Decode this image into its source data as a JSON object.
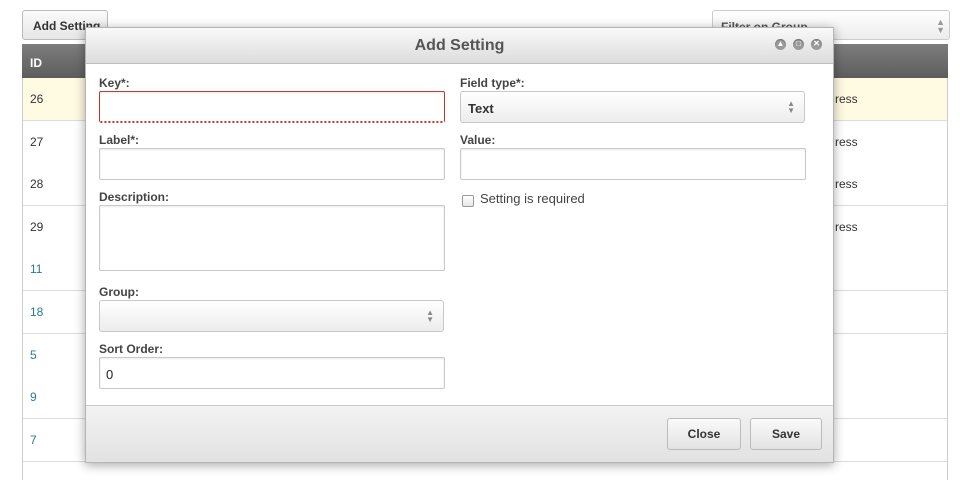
{
  "toolbar": {
    "add_setting_label": "Add Setting",
    "filter_placeholder": "Filter on Group"
  },
  "table": {
    "id_header": "ID",
    "rows": [
      {
        "id": "26",
        "tail": "ress",
        "highlight": true
      },
      {
        "id": "27",
        "tail": "ress"
      },
      {
        "id": "28",
        "tail": "ress"
      },
      {
        "id": "29",
        "tail": "ress"
      },
      {
        "id": "11",
        "tail": ""
      },
      {
        "id": "18",
        "tail": ""
      },
      {
        "id": "5",
        "tail": ""
      },
      {
        "id": "9",
        "tail": ""
      },
      {
        "id": "7",
        "tail": ""
      }
    ]
  },
  "modal": {
    "title": "Add Setting",
    "key_label": "Key*:",
    "key_value": "",
    "label_label": "Label*:",
    "label_value": "",
    "description_label": "Description:",
    "description_value": "",
    "group_label": "Group:",
    "group_value": "",
    "sort_order_label": "Sort Order:",
    "sort_order_value": "0",
    "field_type_label": "Field type*:",
    "field_type_value": "Text",
    "value_label": "Value:",
    "value_value": "",
    "required_label": "Setting is required",
    "required_checked": false,
    "close_label": "Close",
    "save_label": "Save"
  }
}
